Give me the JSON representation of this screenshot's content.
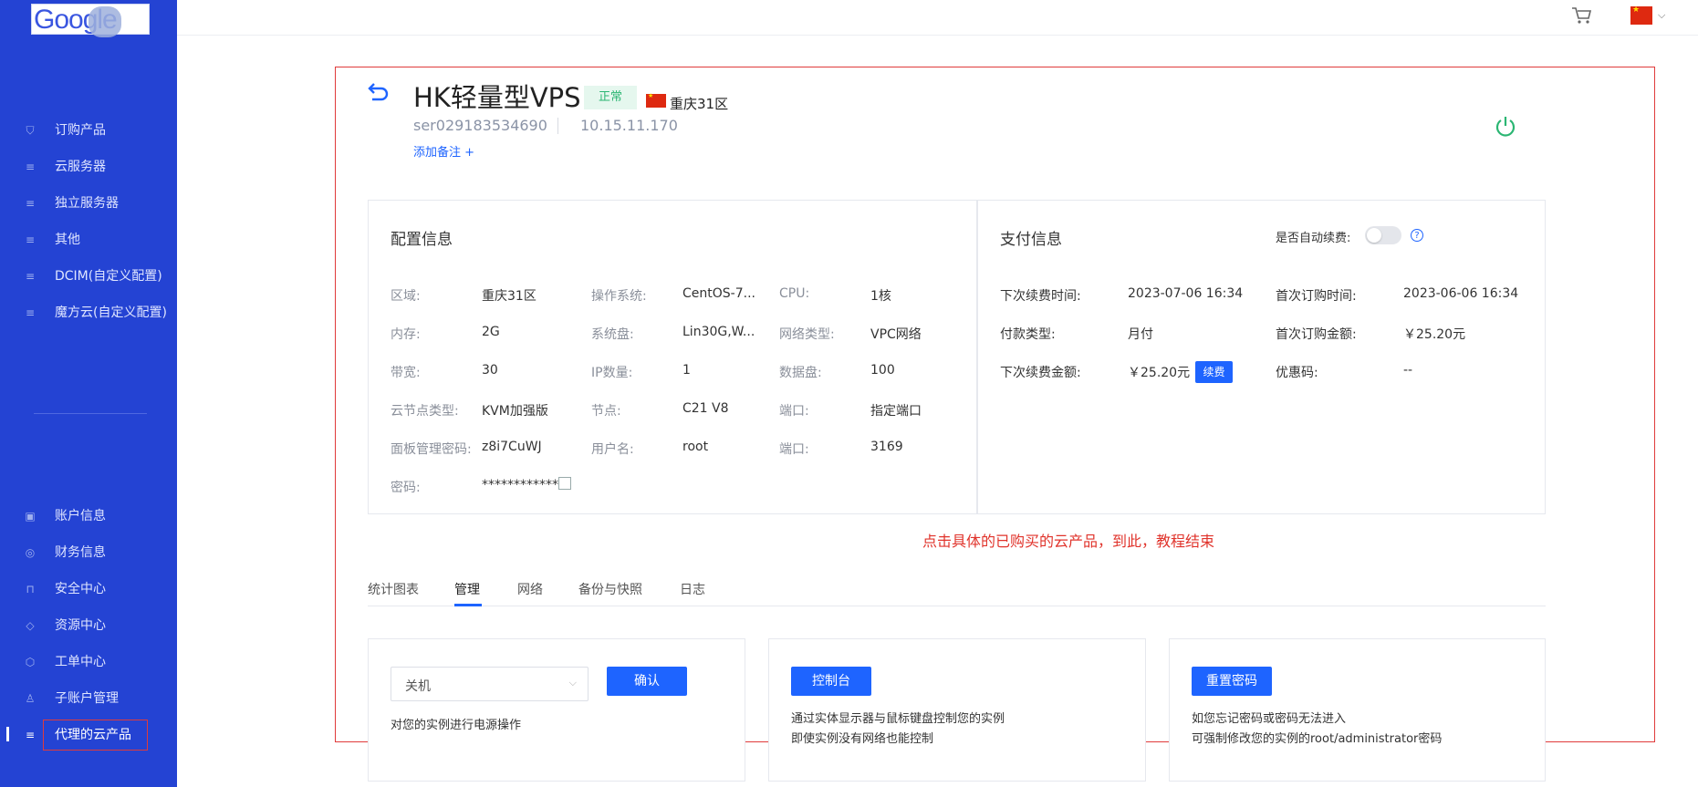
{
  "sidebar": {
    "logo_text": "Google",
    "items": [
      {
        "label": "订购产品",
        "icon": "cart-icon"
      },
      {
        "label": "云服务器",
        "icon": "database-icon"
      },
      {
        "label": "独立服务器",
        "icon": "database-icon"
      },
      {
        "label": "其他",
        "icon": "database-icon"
      },
      {
        "label": "DCIM(自定义配置)",
        "icon": "database-icon"
      },
      {
        "label": "魔方云(自定义配置)",
        "icon": "database-icon"
      }
    ],
    "bottom_items": [
      {
        "label": "账户信息",
        "icon": "user-card-icon"
      },
      {
        "label": "财务信息",
        "icon": "finance-icon"
      },
      {
        "label": "安全中心",
        "icon": "lock-icon"
      },
      {
        "label": "资源中心",
        "icon": "tag-icon"
      },
      {
        "label": "工单中心",
        "icon": "box-icon"
      },
      {
        "label": "子账户管理",
        "icon": "sub-user-icon"
      },
      {
        "label": "代理的云产品",
        "icon": "database-icon"
      }
    ]
  },
  "colors": {
    "sidebar": "#2443d3",
    "accent": "#1e64ff",
    "status_green": "#2bb673",
    "annotation_red": "#e0332b"
  },
  "header": {
    "title": "HK轻量型VPS",
    "status": "正常",
    "region": "重庆31区",
    "server_id": "ser029183534690",
    "ip": "10.15.11.170",
    "add_note": "添加备注 +"
  },
  "config": {
    "title": "配置信息",
    "rows": [
      [
        {
          "k": "区域:",
          "v": "重庆31区"
        },
        {
          "k": "操作系统:",
          "v": "CentOS-7..."
        },
        {
          "k": "CPU:",
          "v": "1核"
        }
      ],
      [
        {
          "k": "内存:",
          "v": "2G"
        },
        {
          "k": "系统盘:",
          "v": "Lin30G,W..."
        },
        {
          "k": "网络类型:",
          "v": "VPC网络"
        }
      ],
      [
        {
          "k": "带宽:",
          "v": "30"
        },
        {
          "k": "IP数量:",
          "v": "1"
        },
        {
          "k": "数据盘:",
          "v": "100"
        }
      ],
      [
        {
          "k": "云节点类型:",
          "v": "KVM加强版"
        },
        {
          "k": "节点:",
          "v": "C21 V8"
        },
        {
          "k": "端口:",
          "v": "指定端口"
        }
      ],
      [
        {
          "k": "面板管理密码:",
          "v": "z8i7CuWJ"
        },
        {
          "k": "用户名:",
          "v": "root"
        },
        {
          "k": "端口:",
          "v": "3169"
        }
      ],
      [
        {
          "k": "密码:",
          "v": "************"
        }
      ]
    ]
  },
  "payment": {
    "title": "支付信息",
    "auto_renew_label": "是否自动续费:",
    "auto_renew_on": false,
    "renew_button": "续费",
    "rows": [
      [
        {
          "k": "下次续费时间:",
          "v": "2023-07-06 16:34"
        },
        {
          "k": "首次订购时间:",
          "v": "2023-06-06 16:34"
        }
      ],
      [
        {
          "k": "付款类型:",
          "v": "月付"
        },
        {
          "k": "首次订购金额:",
          "v": "￥25.20元"
        }
      ],
      [
        {
          "k": "下次续费金额:",
          "v": "￥25.20元"
        },
        {
          "k": "优惠码:",
          "v": "--"
        }
      ]
    ]
  },
  "annotation": "点击具体的已购买的云产品，到此，教程结束",
  "tabs": [
    "统计图表",
    "管理",
    "网络",
    "备份与快照",
    "日志"
  ],
  "active_tab": "管理",
  "cards": {
    "power": {
      "select_value": "关机",
      "button": "确认",
      "desc": "对您的实例进行电源操作"
    },
    "console": {
      "button": "控制台",
      "desc1": "通过实体显示器与鼠标键盘控制您的实例",
      "desc2": "即使实例没有网络也能控制"
    },
    "reset": {
      "button": "重置密码",
      "desc1": "如您忘记密码或密码无法进入",
      "desc2": "可强制修改您的实例的root/administrator密码"
    }
  }
}
